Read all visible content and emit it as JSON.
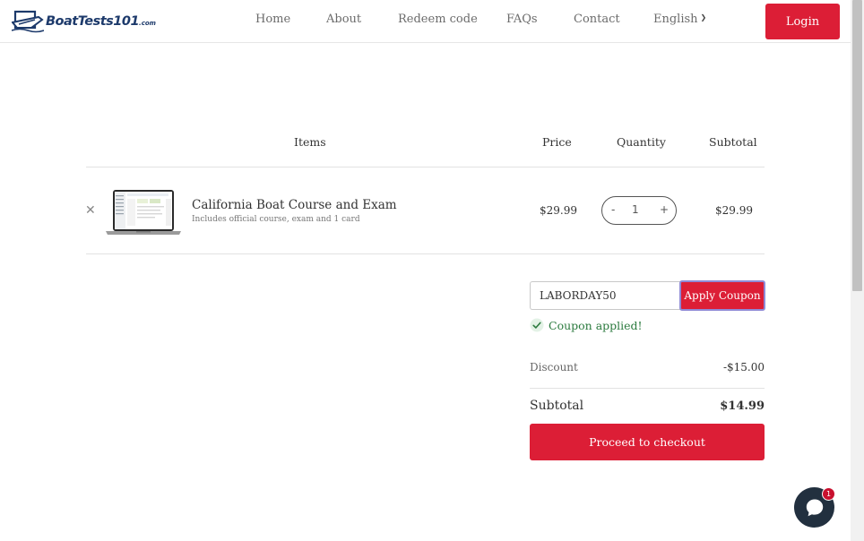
{
  "brand": {
    "logo_text": "BoatTests101",
    "logo_suffix": ".com",
    "logo_icon": "boat-logo-icon"
  },
  "nav": {
    "items": [
      "Home",
      "About",
      "Redeem code",
      "FAQs",
      "Contact"
    ],
    "language": "English",
    "login_label": "Login"
  },
  "cart": {
    "headers": {
      "items": "Items",
      "price": "Price",
      "quantity": "Quantity",
      "subtotal": "Subtotal"
    },
    "line_items": [
      {
        "title": "California Boat Course and Exam",
        "subtitle": "Includes official course, exam and 1 card",
        "price": "$29.99",
        "quantity": "1",
        "subtotal": "$29.99",
        "remove_icon": "close-icon",
        "qty_minus": "-",
        "qty_plus": "+"
      }
    ]
  },
  "coupon": {
    "code": "LABORDAY50",
    "apply_label": "Apply Coupon",
    "status": "Coupon applied!",
    "status_icon": "check-circle-icon"
  },
  "totals": {
    "discount_label": "Discount",
    "discount_value": "-$15.00",
    "subtotal_label": "Subtotal",
    "subtotal_value": "$14.99",
    "checkout_label": "Proceed to checkout"
  },
  "chat": {
    "icon": "chat-bubble-icon",
    "badge_count": "1"
  },
  "colors": {
    "accent": "#dc1e36",
    "success": "#2b7a3e",
    "chat_bg": "#22303f",
    "brand_navy": "#1d3a6b"
  }
}
